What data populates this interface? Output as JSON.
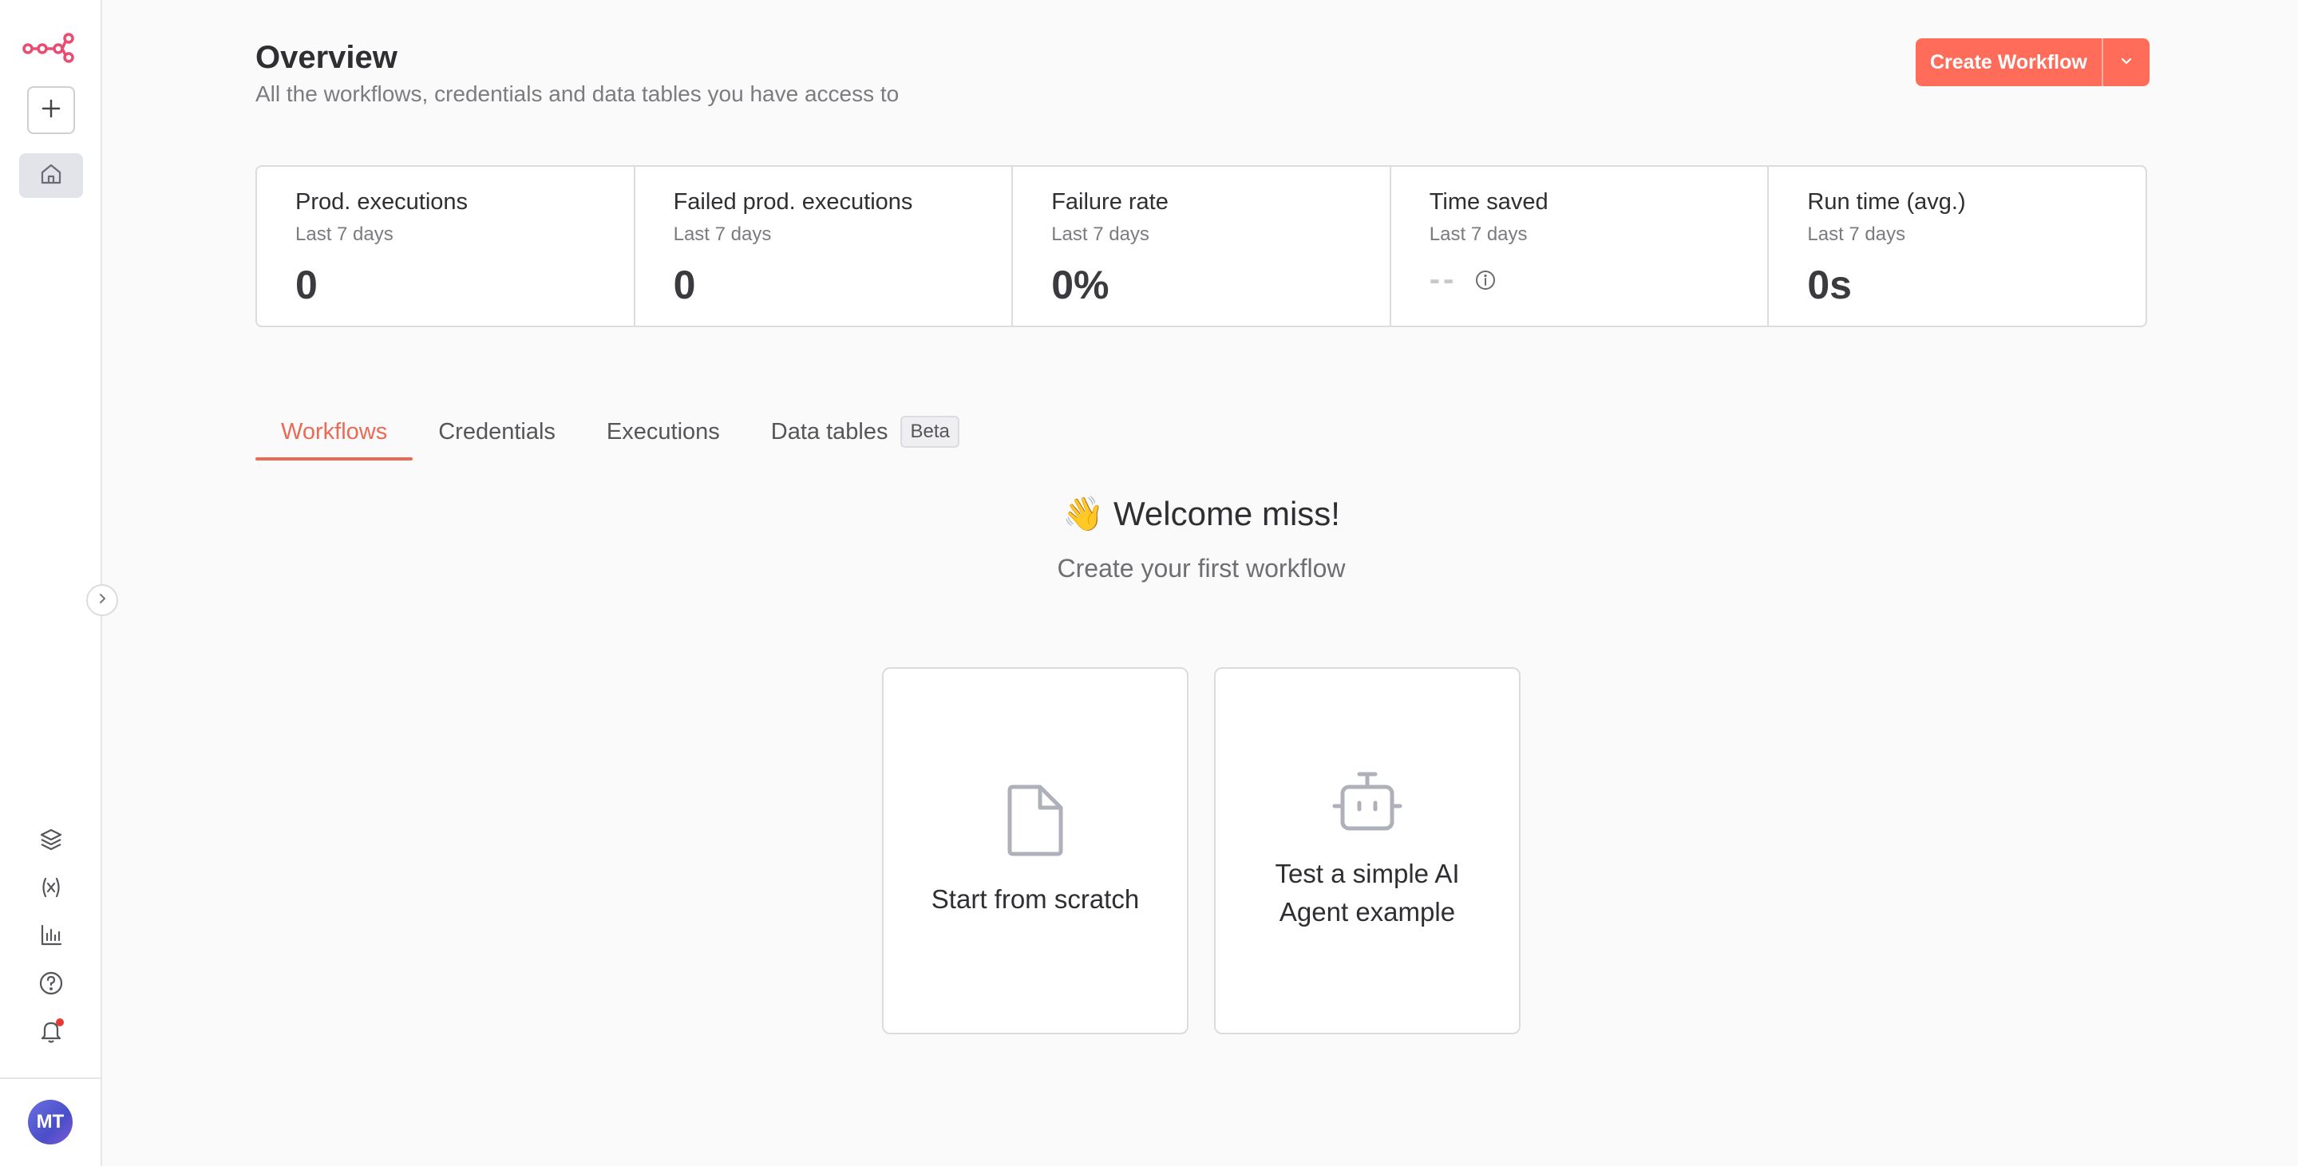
{
  "sidebar": {
    "logo": "n8n-logo",
    "new_button_icon": "plus-icon",
    "home_icon": "home-icon",
    "bottom_icons": [
      "templates-icon",
      "variables-icon",
      "insights-icon",
      "help-icon",
      "notifications-icon"
    ],
    "avatar_initials": "MT",
    "collapse_icon": "chevron-right-icon"
  },
  "header": {
    "title": "Overview",
    "subtitle": "All the workflows, credentials and data tables you have access to",
    "create_button": "Create Workflow"
  },
  "stats": [
    {
      "title": "Prod. executions",
      "period": "Last 7 days",
      "value": "0"
    },
    {
      "title": "Failed prod. executions",
      "period": "Last 7 days",
      "value": "0"
    },
    {
      "title": "Failure rate",
      "period": "Last 7 days",
      "value": "0%"
    },
    {
      "title": "Time saved",
      "period": "Last 7 days",
      "value": "--"
    },
    {
      "title": "Run time (avg.)",
      "period": "Last 7 days",
      "value": "0s"
    }
  ],
  "tabs": [
    {
      "label": "Workflows",
      "active": true
    },
    {
      "label": "Credentials",
      "active": false
    },
    {
      "label": "Executions",
      "active": false
    },
    {
      "label": "Data tables",
      "active": false,
      "badge": "Beta"
    }
  ],
  "welcome": {
    "emoji": "👋",
    "title": "Welcome miss!",
    "subtitle": "Create your first workflow"
  },
  "cards": [
    {
      "label": "Start from scratch",
      "icon": "file-icon"
    },
    {
      "label": "Test a simple AI Agent example",
      "icon": "robot-icon"
    }
  ],
  "colors": {
    "accent": "#ff6d5a",
    "active_tab": "#ea6a56",
    "notification_dot": "#e53935"
  }
}
